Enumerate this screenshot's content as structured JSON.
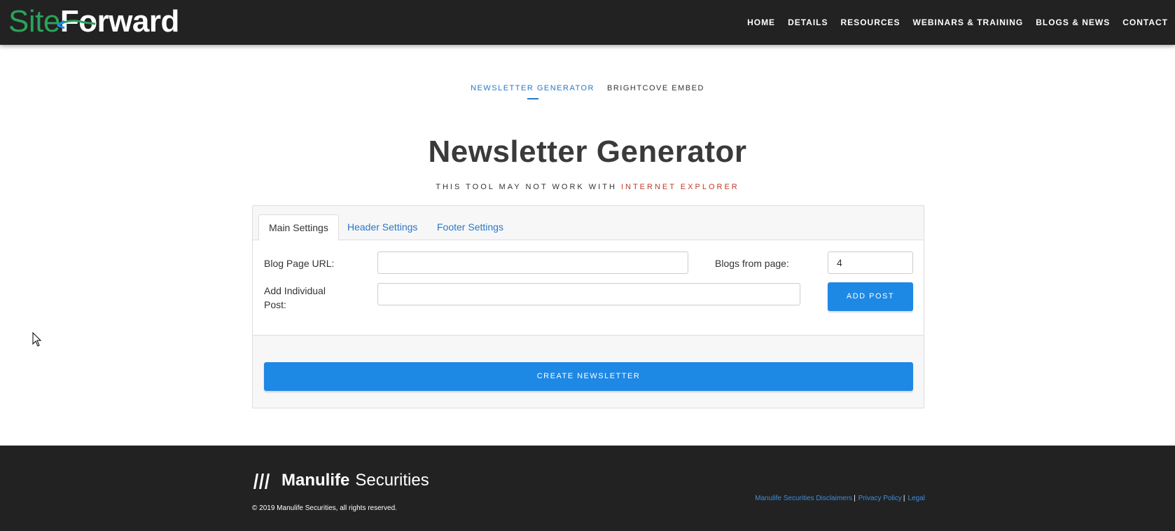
{
  "header": {
    "logo_part1": "Site",
    "logo_part2": "Forward",
    "nav": [
      "HOME",
      "DETAILS",
      "RESOURCES",
      "WEBINARS & TRAINING",
      "BLOGS & NEWS",
      "CONTACT"
    ]
  },
  "subtabs": {
    "active": "NEWSLETTER GENERATOR",
    "other": "BRIGHTCOVE EMBED"
  },
  "page": {
    "title": "Newsletter Generator",
    "warning_prefix": "THIS TOOL MAY NOT WORK WITH ",
    "warning_highlight": "INTERNET EXPLORER"
  },
  "panel": {
    "tabs": [
      "Main Settings",
      "Header Settings",
      "Footer Settings"
    ],
    "blog_url_label": "Blog Page URL:",
    "blog_url_value": "",
    "blogs_from_page_label": "Blogs from page:",
    "blogs_from_page_value": "4",
    "add_post_label": "Add Individual Post:",
    "add_post_value": "",
    "add_post_button": "ADD POST",
    "create_button": "CREATE NEWSLETTER"
  },
  "footer": {
    "brand": "Manulife",
    "brand_suffix": "Securities",
    "copyright": "© 2019 Manulife Securities, all rights reserved.",
    "links": [
      "Manulife Securities Disclaimers",
      "Privacy Policy",
      "Legal"
    ]
  },
  "colors": {
    "accent": "#1e88e5",
    "link": "#2878c8",
    "warning": "#c0392b",
    "dark_bg": "#222222",
    "logo_green": "#2aa35a"
  }
}
